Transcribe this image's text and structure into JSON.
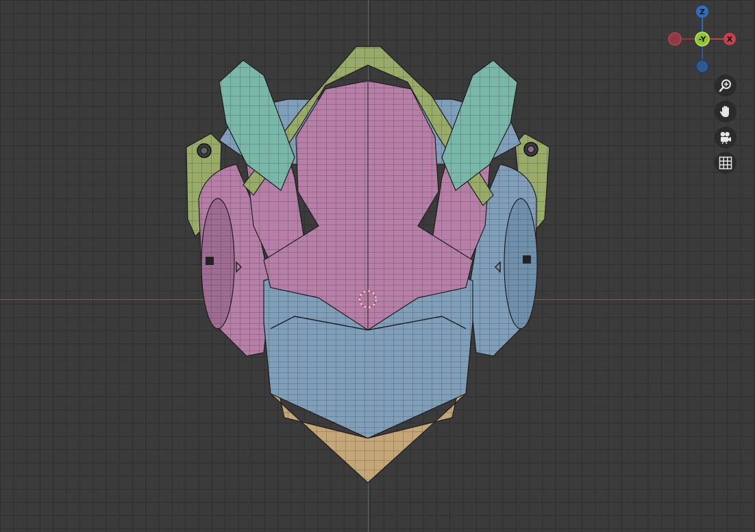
{
  "gizmo": {
    "z_label": "Z",
    "y_label": "-Y",
    "x_label": "X",
    "colors": {
      "z": "#2e6fbd",
      "y": "#8fc630",
      "x": "#c5414d",
      "neg": "#8c3b44",
      "negz": "#2f5a8f"
    }
  },
  "navigation": {
    "buttons": [
      {
        "name": "zoom-button",
        "icon": "zoom-icon"
      },
      {
        "name": "pan-button",
        "icon": "hand-icon"
      },
      {
        "name": "camera-button",
        "icon": "camera-icon"
      },
      {
        "name": "grid-toggle-button",
        "icon": "grid-icon"
      }
    ]
  },
  "mesh_colors": {
    "pink": "#b77fa8",
    "blue": "#7f9fba",
    "teal": "#79b8a8",
    "olive": "#98ac68",
    "tan": "#c5a777"
  }
}
